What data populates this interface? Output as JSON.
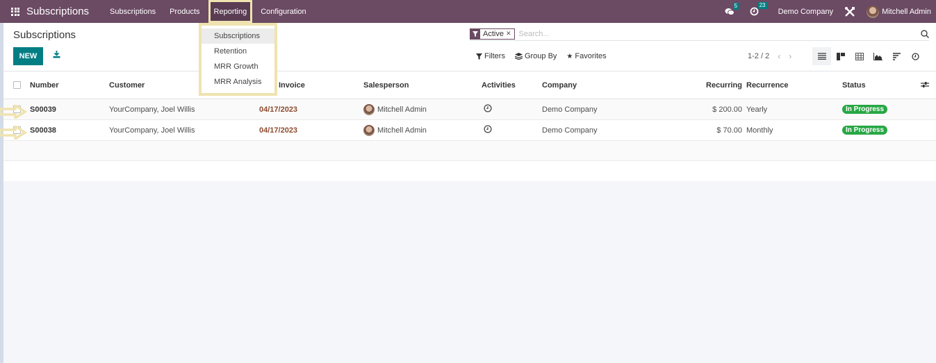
{
  "navbar": {
    "app_name": "Subscriptions",
    "menu": [
      {
        "label": "Subscriptions"
      },
      {
        "label": "Products"
      },
      {
        "label": "Reporting",
        "active": true
      },
      {
        "label": "Configuration"
      }
    ],
    "messages_count": "5",
    "activities_count": "23",
    "company": "Demo Company",
    "user": "Mitchell Admin",
    "bar_color": "#6b4a63"
  },
  "reporting_dropdown": {
    "items": [
      {
        "label": "Subscriptions",
        "hover": true
      },
      {
        "label": "Retention"
      },
      {
        "label": "MRR Growth"
      },
      {
        "label": "MRR Analysis"
      }
    ]
  },
  "control_panel": {
    "title": "Subscriptions",
    "new_label": "NEW",
    "search": {
      "facet_value": "Active",
      "placeholder": "Search..."
    },
    "filters_label": "Filters",
    "group_by_label": "Group By",
    "favorites_label": "Favorites",
    "pager": "1-2 / 2",
    "views": [
      "list-view",
      "kanban-view",
      "pivot-view",
      "graph-view",
      "cohort-view",
      "activity-view"
    ],
    "active_view": "list-view"
  },
  "list": {
    "columns": [
      "Number",
      "Customer",
      "Invoice",
      "Salesperson",
      "Activities",
      "Company",
      "Recurring",
      "Recurrence",
      "Status"
    ],
    "rows": [
      {
        "number": "S00039",
        "customer": "YourCompany, Joel Willis",
        "invoice": "04/17/2023",
        "salesperson": "Mitchell Admin",
        "company": "Demo Company",
        "recurring": "$ 200.00",
        "recurrence": "Yearly",
        "status": "In Progress"
      },
      {
        "number": "S00038",
        "customer": "YourCompany, Joel Willis",
        "invoice": "04/17/2023",
        "salesperson": "Mitchell Admin",
        "company": "Demo Company",
        "recurring": "$ 70.00",
        "recurrence": "Monthly",
        "status": "In Progress"
      }
    ]
  },
  "colors": {
    "primary": "#017e84",
    "date": "#8e4b2f",
    "status_green": "#28a745",
    "highlight": "#efe3b0"
  }
}
